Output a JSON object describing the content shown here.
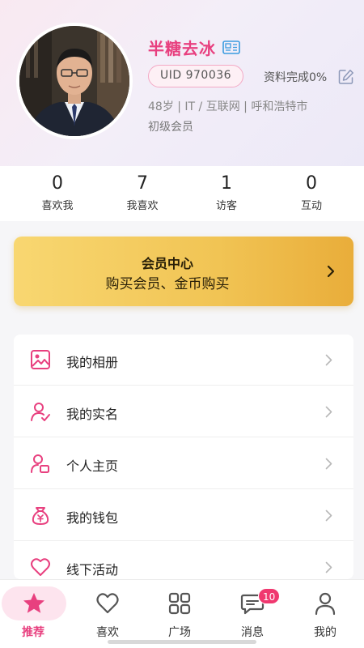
{
  "profile": {
    "nickname": "半糖去冰",
    "uid": "UID 970036",
    "profile_completion": "资料完成0%",
    "info_line": "48岁 | IT / 互联网 | 呼和浩特市",
    "member_level": "初级会员"
  },
  "stats": [
    {
      "value": "0",
      "label": "喜欢我"
    },
    {
      "value": "7",
      "label": "我喜欢"
    },
    {
      "value": "1",
      "label": "访客"
    },
    {
      "value": "0",
      "label": "互动"
    }
  ],
  "vip": {
    "title": "会员中心",
    "subtitle": "购买会员、金币购买"
  },
  "menu": [
    {
      "label": "我的相册",
      "icon": "image-icon"
    },
    {
      "label": "我的实名",
      "icon": "user-check-icon"
    },
    {
      "label": "个人主页",
      "icon": "user-home-icon"
    },
    {
      "label": "我的钱包",
      "icon": "wallet-icon"
    },
    {
      "label": "线下活动",
      "icon": "heart-icon"
    }
  ],
  "tabs": [
    {
      "label": "推荐",
      "icon": "star-icon",
      "active": true
    },
    {
      "label": "喜欢",
      "icon": "heart-icon"
    },
    {
      "label": "广场",
      "icon": "grid-icon"
    },
    {
      "label": "消息",
      "icon": "chat-icon",
      "badge": "10"
    },
    {
      "label": "我的",
      "icon": "person-icon"
    }
  ],
  "colors": {
    "accent": "#e8407f",
    "vip_gold": "#f1c454",
    "badge": "#f0386f"
  }
}
